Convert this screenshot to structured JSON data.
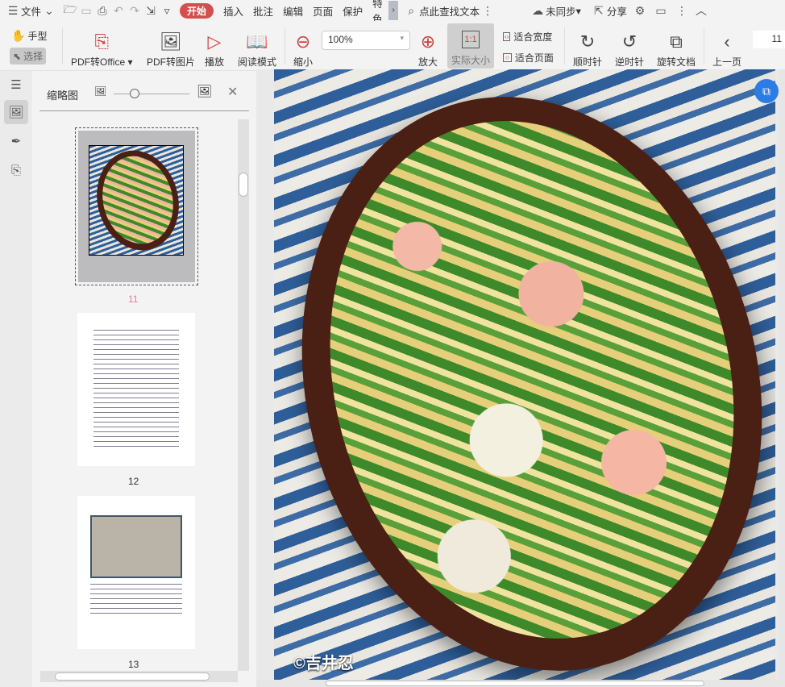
{
  "menu": {
    "file": "文件",
    "tabs": [
      "开始",
      "插入",
      "批注",
      "编辑",
      "页面",
      "保护",
      "特色"
    ],
    "search_placeholder": "点此查找文本",
    "sync": "未同步",
    "share": "分享"
  },
  "toolbar": {
    "hand": "手型",
    "select": "选择",
    "pdf_to_office": "PDF转Office",
    "pdf_to_image": "PDF转图片",
    "play": "播放",
    "read_mode": "阅读模式",
    "zoom_out": "缩小",
    "zoom_value": "100%",
    "zoom_in": "放大",
    "actual_size": "实际大小",
    "fit_width": "适合宽度",
    "fit_page": "适合页面",
    "clockwise": "顺时针",
    "counterclockwise": "逆时针",
    "rotate_doc": "旋转文档",
    "prev_page": "上一页",
    "page_number": "11"
  },
  "sidebar": {
    "title": "缩略图",
    "pages": [
      "11",
      "12",
      "13"
    ]
  },
  "document": {
    "watermark": "©吉井忍"
  },
  "colors": {
    "accent": "#d34e4e",
    "page_label_active": "#e87a9a"
  }
}
